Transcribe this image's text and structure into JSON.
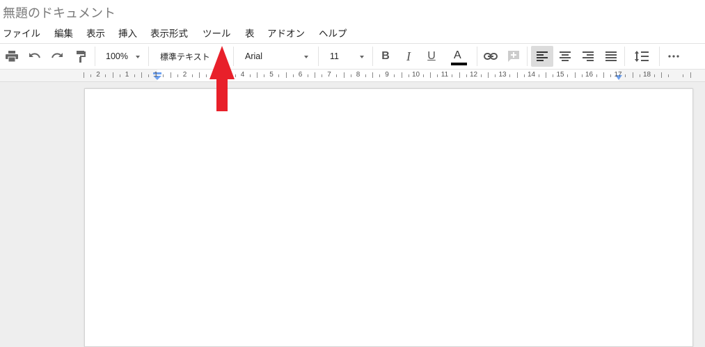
{
  "document": {
    "title": "無題のドキュメント"
  },
  "menubar": {
    "items": [
      {
        "label": "ファイル"
      },
      {
        "label": "編集"
      },
      {
        "label": "表示"
      },
      {
        "label": "挿入"
      },
      {
        "label": "表示形式"
      },
      {
        "label": "ツール"
      },
      {
        "label": "表"
      },
      {
        "label": "アドオン"
      },
      {
        "label": "ヘルプ"
      }
    ]
  },
  "toolbar": {
    "print_icon": "print-icon",
    "undo_icon": "undo-icon",
    "redo_icon": "redo-icon",
    "paint_format_icon": "paint-format-icon",
    "zoom": "100%",
    "style": "標準テキスト",
    "font": "Arial",
    "font_size": "11",
    "bold_label": "B",
    "italic_label": "I",
    "underline_label": "U",
    "text_color_label": "A",
    "text_color": "#000000",
    "link_icon": "link-icon",
    "comment_icon": "add-comment-icon",
    "align_active": "left",
    "line_spacing_icon": "line-spacing-icon",
    "more_icon": "more-icon"
  },
  "ruler": {
    "numbers": [
      "2",
      "1",
      "1",
      "2",
      "3",
      "4",
      "5",
      "6",
      "7",
      "8",
      "9",
      "10",
      "11",
      "12",
      "13",
      "14",
      "15",
      "16",
      "17",
      "18"
    ]
  },
  "colors": {
    "annotation_arrow": "#e8202a",
    "active_button_bg": "#dcdcdc",
    "canvas_bg": "#eeeeee"
  }
}
